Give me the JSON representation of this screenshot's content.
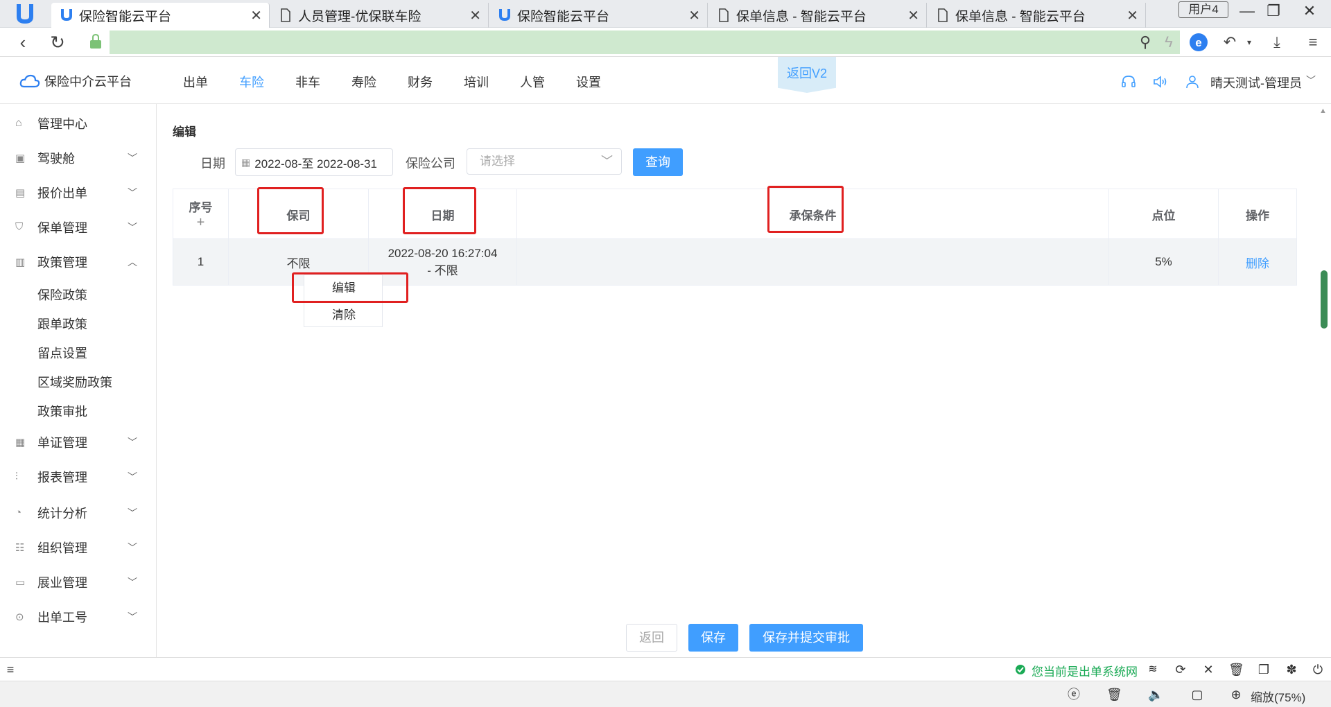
{
  "browser": {
    "tabs": [
      {
        "title": "保险智能云平台",
        "active": true,
        "icon": "brand-icon"
      },
      {
        "title": "人员管理-优保联车险",
        "active": false,
        "icon": "page-icon"
      },
      {
        "title": "保险智能云平台",
        "active": false,
        "icon": "brand-icon"
      },
      {
        "title": "保单信息 - 智能云平台",
        "active": false,
        "icon": "page-icon"
      },
      {
        "title": "保单信息 - 智能云平台",
        "active": false,
        "icon": "page-icon"
      }
    ],
    "user_profile": "用户4",
    "address_bar_color": "#cfe9cf"
  },
  "header": {
    "brand": "保险中介云平台",
    "nav": [
      "出单",
      "车险",
      "非车",
      "寿险",
      "财务",
      "培训",
      "人管",
      "设置"
    ],
    "active_nav": "车险",
    "v2_button": "返回V2",
    "user": "晴天测试-管理员"
  },
  "sidebar": {
    "items": [
      {
        "label": "管理中心",
        "icon": "home-icon",
        "chevron": ""
      },
      {
        "label": "驾驶舱",
        "icon": "dashboard-icon",
        "chevron": "﹀"
      },
      {
        "label": "报价出单",
        "icon": "document-icon",
        "chevron": "﹀"
      },
      {
        "label": "保单管理",
        "icon": "shield-icon",
        "chevron": "﹀"
      },
      {
        "label": "政策管理",
        "icon": "policy-icon",
        "chevron": "︿"
      }
    ],
    "sub_items": [
      "保险政策",
      "跟单政策",
      "留点设置",
      "区域奖励政策",
      "政策审批"
    ],
    "items_after": [
      {
        "label": "单证管理",
        "icon": "certificate-icon",
        "chevron": "﹀"
      },
      {
        "label": "报表管理",
        "icon": "report-icon",
        "chevron": "﹀"
      },
      {
        "label": "统计分析",
        "icon": "pie-chart-icon",
        "chevron": "﹀"
      },
      {
        "label": "组织管理",
        "icon": "org-icon",
        "chevron": "﹀"
      },
      {
        "label": "展业管理",
        "icon": "briefcase-icon",
        "chevron": "﹀"
      },
      {
        "label": "出单工号",
        "icon": "id-icon",
        "chevron": "﹀"
      }
    ]
  },
  "main": {
    "title": "编辑",
    "filters": {
      "date_label": "日期",
      "date_range": "2022-08-至 2022-08-31",
      "company_label": "保险公司",
      "company_placeholder": "请选择",
      "query_button": "查询"
    },
    "table": {
      "columns": [
        "序号",
        "保司",
        "日期",
        "承保条件",
        "点位",
        "操作"
      ],
      "add_symbol": "+",
      "rows": [
        {
          "index": "1",
          "company": "不限",
          "date_line1": "2022-08-20 16:27:04",
          "date_line2": "- 不限",
          "condition": "",
          "points": "5%",
          "action": "删除"
        }
      ]
    },
    "context_menu": [
      "编辑",
      "清除"
    ],
    "footer_buttons": {
      "back": "返回",
      "save": "保存",
      "save_submit": "保存并提交审批"
    }
  },
  "statusbar": {
    "message": "您当前是出单系统网",
    "zoom": "缩放(75%)"
  },
  "colors": {
    "accent": "#409eff",
    "highlight_box": "#e02020",
    "status_ok": "#1aaa55"
  }
}
